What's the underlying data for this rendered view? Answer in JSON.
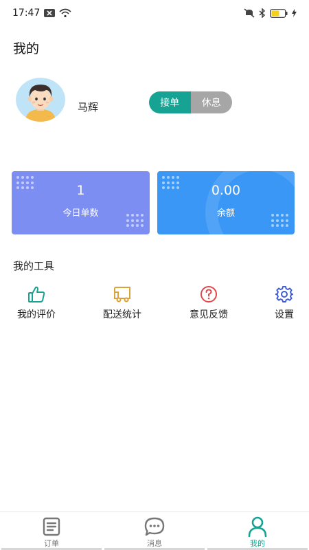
{
  "status_bar": {
    "time": "17:47",
    "icons": [
      "notification-x-icon",
      "wifi-icon",
      "mute-icon",
      "bluetooth-icon",
      "battery-icon",
      "charging-icon"
    ]
  },
  "header": {
    "title": "我的"
  },
  "profile": {
    "name": "马辉",
    "avatar_icon": "avatar-boy-icon",
    "toggle": {
      "on_label": "接单",
      "off_label": "休息"
    }
  },
  "stats": {
    "orders": {
      "value": "1",
      "label": "今日单数"
    },
    "balance": {
      "value": "0.00",
      "label": "余额"
    }
  },
  "tools": {
    "title": "我的工具",
    "items": [
      {
        "label": "我的评价",
        "icon": "thumbs-up-icon",
        "color": "#16a394"
      },
      {
        "label": "配送统计",
        "icon": "delivery-truck-icon",
        "color": "#d9a23a"
      },
      {
        "label": "意见反馈",
        "icon": "question-circle-icon",
        "color": "#e0474c"
      },
      {
        "label": "设置",
        "icon": "gear-icon",
        "color": "#3d5bd6"
      }
    ]
  },
  "bottom_nav": {
    "items": [
      {
        "label": "订单",
        "icon": "document-icon"
      },
      {
        "label": "消息",
        "icon": "chat-bubble-icon"
      },
      {
        "label": "我的",
        "icon": "person-icon",
        "active": true
      }
    ]
  },
  "colors": {
    "accent": "#16a394",
    "orders_card": "#7c8ef2",
    "balance_card": "#3a97f6",
    "toggle_off": "#a6a6a6"
  }
}
